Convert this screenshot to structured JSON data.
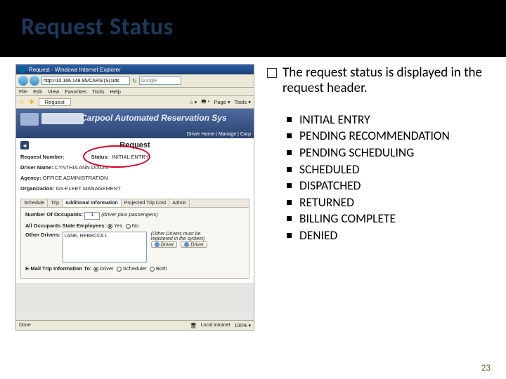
{
  "slide": {
    "title": "Request Status",
    "page_number": "23"
  },
  "explain": {
    "lead": "The request status is displayed in the request header.",
    "statuses": [
      "INITIAL ENTRY",
      "PENDING RECOMMENDATION",
      "PENDING SCHEDULING",
      "SCHEDULED",
      "DISPATCHED",
      "RETURNED",
      "BILLING COMPLETE",
      "DENIED"
    ]
  },
  "ie": {
    "window_title": "Request - Windows Internet Explorer",
    "url": "http://10.166.148.95/CARS/(S(1ids",
    "search_placeholder": "Google",
    "menu": [
      "File",
      "Edit",
      "View",
      "Favorites",
      "Tools",
      "Help"
    ],
    "toolbar": {
      "fav": "☆",
      "tab": "Request",
      "home": "⌂ ▾",
      "print": "🖶 ▾",
      "page": "Page ▾",
      "tools": "Tools ▾"
    },
    "status": {
      "done": "Done",
      "zone": "Local intranet",
      "zoom": "100%  ▾"
    }
  },
  "app": {
    "banner_title": "Carpool Automated Reservation Sys",
    "banner_nav": "Driver Home  |  Manage  |  Carp",
    "page_heading": "Request",
    "fields": {
      "request_number_label": "Request Number:",
      "status_label": "Status:",
      "status_value": "INITIAL ENTRY",
      "driver_name_label": "Driver Name:",
      "driver_name_value": "CYNTHIA ANN DIXON",
      "agency_label": "Agency:",
      "agency_value": "OFFICE ADMINISTRATION",
      "org_label": "Organization:",
      "org_value": "GS-FLEET MANAGEMENT"
    },
    "tabs": [
      "Schedule",
      "Trip",
      "Additional Information",
      "Projected Trip Cost",
      "Admin"
    ],
    "form": {
      "occupants_label": "Number Of Occupants:",
      "occupants_value": "1",
      "occupants_hint": "(driver plus passengers)",
      "employees_label": "All Occupants State Employees:",
      "yes": "Yes",
      "no": "No",
      "other_drivers_label": "Other Drivers:",
      "other_driver_value": "LANE, REBECCA L",
      "other_drivers_note": "(Other Drivers must be registered in the system)",
      "btn_driver": "Driver",
      "email_label": "E-Mail Trip Information To:",
      "email_opts": {
        "driver": "Driver",
        "scheduler": "Scheduler",
        "both": "Both"
      }
    }
  }
}
